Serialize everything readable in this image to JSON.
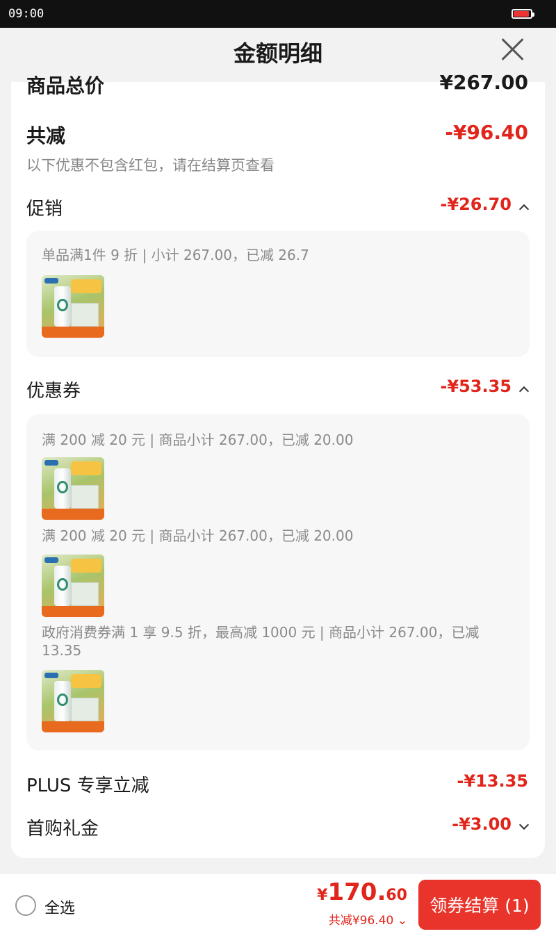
{
  "status": {
    "time": "09:00"
  },
  "header": {
    "title": "金额明细"
  },
  "summary": {
    "total_label": "商品总价",
    "total_value": "¥267.00",
    "reduce_label": "共减",
    "reduce_value": "-¥96.40",
    "note": "以下优惠不包含红包，请在结算页查看"
  },
  "promotion": {
    "label": "促销",
    "value": "-¥26.70",
    "items": [
      "单品满1件 9 折 | 小计 267.00，已减 26.7"
    ]
  },
  "coupon": {
    "label": "优惠券",
    "value": "-¥53.35",
    "items": [
      "满 200 减 20 元 | 商品小计 267.00，已减 20.00",
      "满 200 减 20 元 | 商品小计 267.00，已减 20.00",
      "政府消费券满 1 享 9.5 折，最高减 1000 元 | 商品小计 267.00，已减 13.35"
    ]
  },
  "plus": {
    "label": "PLUS 专享立减",
    "value": "-¥13.35"
  },
  "gift": {
    "label": "首购礼金",
    "value": "-¥3.00"
  },
  "footer": {
    "select_all": "全选",
    "price_symbol": "¥",
    "price_int": "170.",
    "price_dec": "60",
    "reduce_text": "共减¥96.40",
    "checkout_label": "领券结算 (1)"
  },
  "colors": {
    "accent": "#e1251b",
    "button": "#e8342b"
  }
}
